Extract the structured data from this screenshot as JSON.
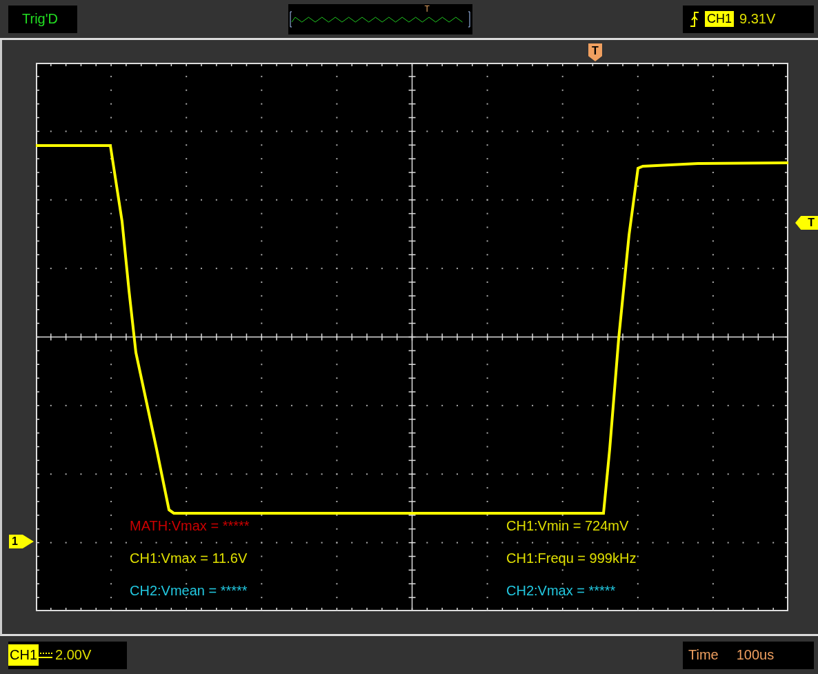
{
  "top_bar": {
    "status": "Trig'D",
    "preview": {
      "trigger_mark": "T"
    },
    "trigger": {
      "source": "CH1",
      "voltage": "9.31V"
    }
  },
  "display": {
    "trigger_position_mark": "T",
    "trigger_level_mark": "T",
    "channel_marker": "1",
    "measurements": [
      {
        "text": "MATH:Vmax = *****",
        "color": "#cc0000"
      },
      {
        "text": "CH1:Vmin = 724mV",
        "color": "#e0e000"
      },
      {
        "text": "CH1:Vmax = 11.6V",
        "color": "#e0e000"
      },
      {
        "text": "CH1:Frequ = 999kHz",
        "color": "#e0e000"
      },
      {
        "text": "CH2:Vmean = *****",
        "color": "#22c8e0"
      },
      {
        "text": "CH2:Vmax = *****",
        "color": "#22c8e0"
      }
    ]
  },
  "bottom_bar": {
    "channel": {
      "name": "CH1",
      "scale": "2.00V"
    },
    "timebase": {
      "label": "Time",
      "value": "100us"
    }
  }
}
